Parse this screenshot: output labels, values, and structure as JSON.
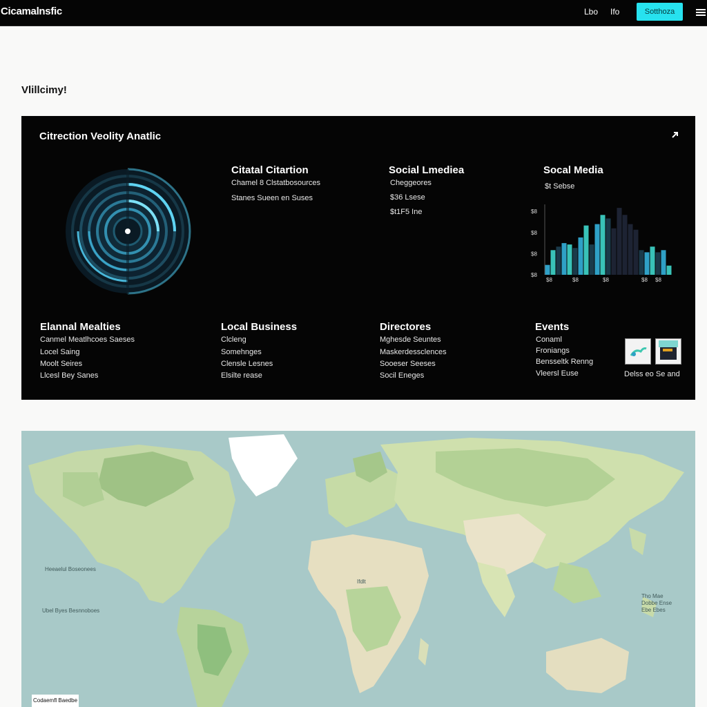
{
  "app": {
    "title": "Cicamalnsfic"
  },
  "topbar": {
    "nav": [
      "Lbo",
      "Ifo"
    ],
    "cta_label": "Sotthoza",
    "icons": [
      "menu-corner-icon"
    ]
  },
  "page": {
    "heading": "Vlillcimy!"
  },
  "panel": {
    "title": "Citrection Veolity Anatlic",
    "expand_icon": "arrow-icon",
    "metrics": [
      {
        "title": "Citatal Citartion",
        "lines": [
          "Chamel 8 Clstatbosources",
          "Stanes Sueen en Suses"
        ]
      },
      {
        "title": "Social Lmediea",
        "lines": [
          "Cheggeores",
          "$36 Lsese",
          "$t1F5 Ine"
        ]
      },
      {
        "title": "Socal Media",
        "lines": [
          "$t Sebse"
        ]
      }
    ],
    "categories": [
      {
        "title": "Elannal Mealties",
        "items": [
          "Canmel Meatlhcoes Saeses",
          "Locel Saing",
          "Moolt Seires",
          "Llcesl Bey Sanes"
        ]
      },
      {
        "title": "Local Business",
        "items": [
          "Clcleng",
          "Somehnges",
          "Clensle Lesnes",
          "Elsilte rease"
        ]
      },
      {
        "title": "Directores",
        "items": [
          "Mghesde Seuntes",
          "Maskerdessclences",
          "Sooeser Seeses",
          "Socil Eneges"
        ]
      },
      {
        "title": "Events",
        "items": [
          "Conaml",
          "Froniangs",
          "Bensseltk Renng",
          "Vleersl Euse"
        ]
      }
    ],
    "thumb_caption": "Delss eo Se and"
  },
  "chart_data": {
    "type": "bar",
    "series": [
      {
        "name": "",
        "values": [
          14,
          35,
          40,
          45,
          43,
          38,
          53,
          70,
          43,
          72,
          85,
          80,
          66,
          95,
          85,
          72,
          64,
          35,
          32,
          40,
          32,
          35,
          13
        ]
      }
    ],
    "y_tick_labels": [
      "$8",
      "$8",
      "$8",
      "$8"
    ],
    "x_tick_labels": [
      "$8",
      "$8",
      "$8",
      "$8",
      "$8"
    ],
    "ylim": [
      0,
      100
    ],
    "colors": [
      "#1a3a4a",
      "#2fa0c6",
      "#39c2b8",
      "#1d2333"
    ]
  },
  "map": {
    "labels": [
      "Heeaelul Boseonees",
      "Ubel Byes Besnnoboes",
      "Ifdlt",
      "Tho Mae Dobbe Ense Ebe Ebes"
    ],
    "caption": "Codaemfl Baedbe"
  }
}
